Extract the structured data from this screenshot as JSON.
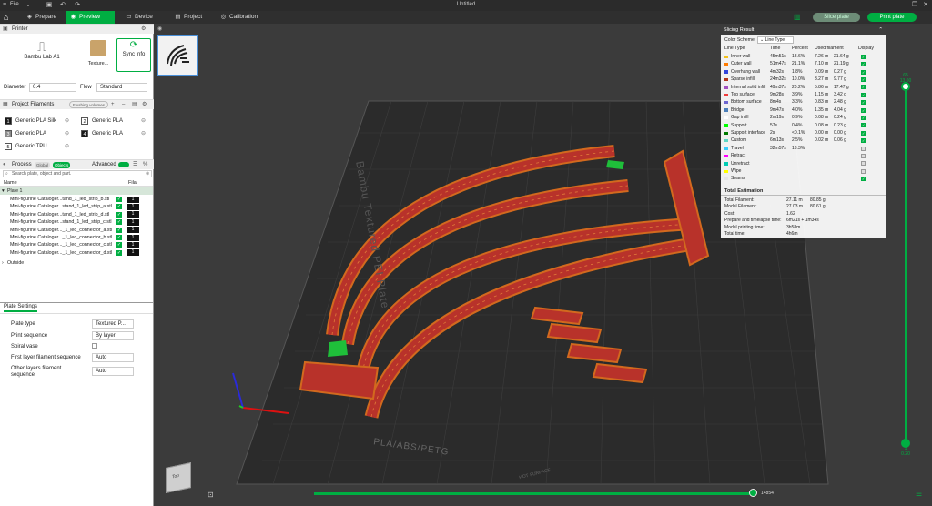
{
  "titlebar": {
    "file_label": "File",
    "title": "Untitled"
  },
  "nav": {
    "tabs": [
      {
        "label": "Prepare",
        "icon": "cube-icon"
      },
      {
        "label": "Preview",
        "icon": "eye-icon"
      },
      {
        "label": "Device",
        "icon": "device-icon"
      },
      {
        "label": "Project",
        "icon": "project-icon"
      },
      {
        "label": "Calibration",
        "icon": "calibration-icon"
      }
    ],
    "slice_plate": "Slice plate",
    "print_plate": "Print plate"
  },
  "printer": {
    "section_title": "Printer",
    "name": "Bambu Lab A1",
    "plate": "Texture...",
    "sync": "Sync info",
    "diameter_label": "Diameter",
    "diameter_value": "0.4",
    "flow_label": "Flow",
    "flow_value": "Standard"
  },
  "filaments": {
    "section_title": "Project Filaments",
    "flushing": "Flushing volumes",
    "items": [
      {
        "num": "1",
        "name": "Generic PLA Silk",
        "color": "#1a1a1a"
      },
      {
        "num": "2",
        "name": "Generic PLA",
        "color": "#ffffff"
      },
      {
        "num": "3",
        "name": "Generic PLA",
        "color": "#8a8a8a"
      },
      {
        "num": "4",
        "name": "Generic PLA",
        "color": "#1a1a1a"
      },
      {
        "num": "5",
        "name": "Generic TPU",
        "color": "#ffffff"
      }
    ]
  },
  "process": {
    "section_title": "Process",
    "global": "Global",
    "objects": "Objects",
    "advanced": "Advanced",
    "search_placeholder": "Search plate, object and part.",
    "col_name": "Name",
    "col_fila": "Fila",
    "plate": "Plate 1",
    "objects_list": [
      {
        "name": "Mini-figurine Cataloger...tand_1_led_strip_b.stl",
        "fila": "1"
      },
      {
        "name": "Mini-figurine Cataloger...stand_1_led_strip_a.stl",
        "fila": "1"
      },
      {
        "name": "Mini-figurine Cataloger...tand_1_led_strip_d.stl",
        "fila": "1"
      },
      {
        "name": "Mini-figurine Cataloger...stand_1_led_strip_c.stl",
        "fila": "1"
      },
      {
        "name": "Mini-figurine Cataloger..._1_led_connector_a.stl",
        "fila": "1"
      },
      {
        "name": "Mini-figurine Cataloger..._1_led_connector_b.stl",
        "fila": "1"
      },
      {
        "name": "Mini-figurine Cataloger..._1_led_connector_c.stl",
        "fila": "1"
      },
      {
        "name": "Mini-figurine Cataloger..._1_led_connector_d.stl",
        "fila": "1"
      }
    ],
    "outside": "Outside"
  },
  "plate_settings": {
    "tab": "Plate Settings",
    "rows": [
      {
        "label": "Plate type",
        "value": "Textured P..."
      },
      {
        "label": "Print sequence",
        "value": "By layer"
      },
      {
        "label": "Spiral vase",
        "value": ""
      },
      {
        "label": "First layer filament sequence",
        "value": "Auto"
      },
      {
        "label": "Other layers filament sequence",
        "value": "Auto"
      }
    ]
  },
  "slicing": {
    "title": "Slicing Result",
    "color_scheme_label": "Color Scheme",
    "color_scheme_value": "Line Type",
    "headers": [
      "Line Type",
      "Time",
      "Percent",
      "Used filament",
      "Display"
    ],
    "rows": [
      {
        "type": "Inner wall",
        "time": "45m51s",
        "pct": "18.6%",
        "len": "7.26 m",
        "g": "21.64 g",
        "color": "#f2c11c",
        "on": true
      },
      {
        "type": "Outer wall",
        "time": "51m47s",
        "pct": "21.1%",
        "len": "7.10 m",
        "g": "21.19 g",
        "color": "#ff7b00",
        "on": true
      },
      {
        "type": "Overhang wall",
        "time": "4m32s",
        "pct": "1.8%",
        "len": "0.09 m",
        "g": "0.27 g",
        "color": "#3246dc",
        "on": true
      },
      {
        "type": "Sparse infill",
        "time": "24m32s",
        "pct": "10.0%",
        "len": "3.27 m",
        "g": "9.77 g",
        "color": "#b2361c",
        "on": true
      },
      {
        "type": "Internal solid infill",
        "time": "49m37s",
        "pct": "20.2%",
        "len": "5.86 m",
        "g": "17.47 g",
        "color": "#a352c2",
        "on": true
      },
      {
        "type": "Top surface",
        "time": "9m28s",
        "pct": "3.9%",
        "len": "1.15 m",
        "g": "3.42 g",
        "color": "#f03c3c",
        "on": true
      },
      {
        "type": "Bottom surface",
        "time": "8m4s",
        "pct": "3.3%",
        "len": "0.83 m",
        "g": "2.48 g",
        "color": "#6e66d0",
        "on": true
      },
      {
        "type": "Bridge",
        "time": "9m47s",
        "pct": "4.0%",
        "len": "1.35 m",
        "g": "4.04 g",
        "color": "#4d80ba",
        "on": true
      },
      {
        "type": "Gap infill",
        "time": "2m19s",
        "pct": "0.9%",
        "len": "0.08 m",
        "g": "0.24 g",
        "color": "#ffffff",
        "on": true
      },
      {
        "type": "Support",
        "time": "57s",
        "pct": "0.4%",
        "len": "0.08 m",
        "g": "0.23 g",
        "color": "#00ff00",
        "on": true
      },
      {
        "type": "Support interface",
        "time": "2s",
        "pct": "<0.1%",
        "len": "0.00 m",
        "g": "0.00 g",
        "color": "#007a00",
        "on": true
      },
      {
        "type": "Custom",
        "time": "6m13s",
        "pct": "2.5%",
        "len": "0.02 m",
        "g": "0.06 g",
        "color": "#5ed6c4",
        "on": true
      },
      {
        "type": "Travel",
        "time": "32m57s",
        "pct": "13.3%",
        "len": "",
        "g": "",
        "color": "#38ccfa",
        "on": false
      },
      {
        "type": "Retract",
        "time": "",
        "pct": "",
        "len": "",
        "g": "",
        "color": "#ff00ff",
        "on": false
      },
      {
        "type": "Unretract",
        "time": "",
        "pct": "",
        "len": "",
        "g": "",
        "color": "#00ccb3",
        "on": false
      },
      {
        "type": "Wipe",
        "time": "",
        "pct": "",
        "len": "",
        "g": "",
        "color": "#ffff00",
        "on": false
      },
      {
        "type": "Seams",
        "time": "",
        "pct": "",
        "len": "",
        "g": "",
        "color": "#e6e6e6",
        "on": true
      }
    ],
    "total_title": "Total Estimation",
    "totals": [
      {
        "label": "Total Filament:",
        "v1": "27.11 m",
        "v2": "80.85 g"
      },
      {
        "label": "Model Filament:",
        "v1": "27.03 m",
        "v2": "80.61 g"
      },
      {
        "label": "Cost:",
        "v1": "1.62",
        "v2": ""
      },
      {
        "label": "Prepare and timelapse time:",
        "v1": "6m21s + 1m34s",
        "v2": ""
      },
      {
        "label": "Model printing time:",
        "v1": "3h58m",
        "v2": ""
      },
      {
        "label": "Total time:",
        "v1": "4h6m",
        "v2": ""
      }
    ]
  },
  "layers": {
    "top_value": "65",
    "top_height": "13.00",
    "bottom_value": "1",
    "bottom_height": "0.20"
  },
  "moves": {
    "value": "14854"
  },
  "bed": {
    "brand_text": "Bambu Textured PEI Plate",
    "bottom_text": "PLA/ABS/PETG",
    "hot_surface": "HOT SURFACE"
  },
  "view_cube": {
    "face": "Top"
  },
  "colors": {
    "accent": "#00ae42",
    "model": "#c0392b",
    "model_edge": "#d2691e",
    "bed": "#2a2a2a"
  }
}
